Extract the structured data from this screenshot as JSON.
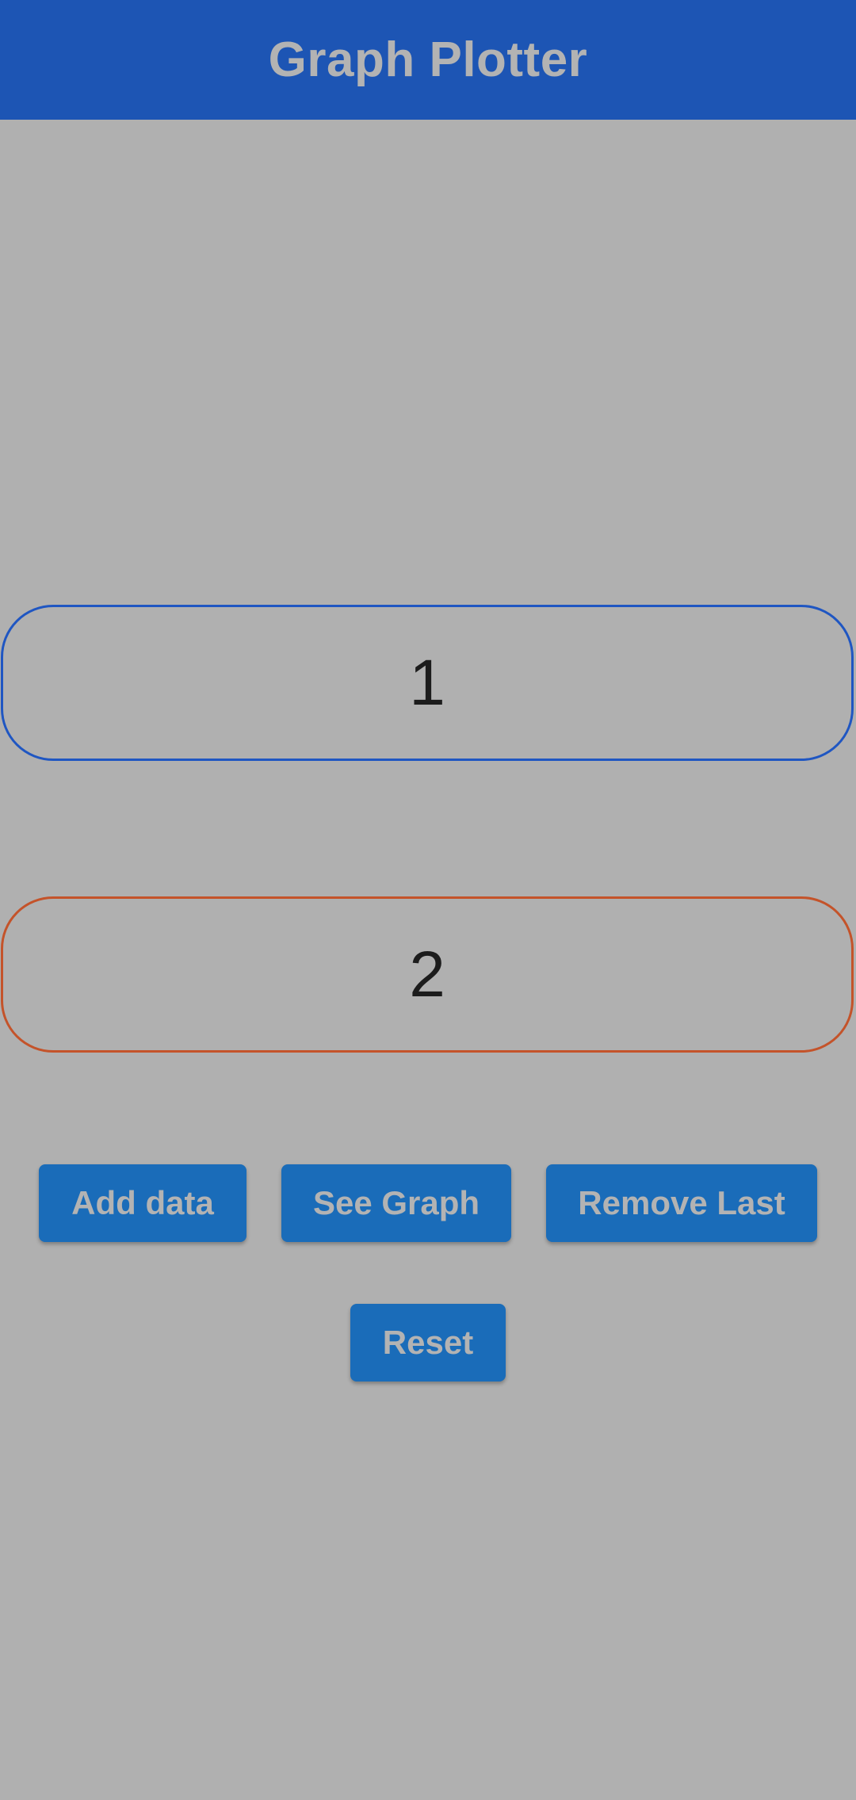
{
  "app_bar": {
    "title": "Graph Plotter"
  },
  "inputs": {
    "x_value": "1",
    "y_value": "2"
  },
  "buttons": {
    "add_data": "Add data",
    "see_graph": "See Graph",
    "remove_last": "Remove Last",
    "reset": "Reset"
  },
  "colors": {
    "app_bar": "#1d55b4",
    "background": "#b0b0b0",
    "button": "#1a6cb9",
    "field_1_border": "#1f56c2",
    "field_2_border": "#c4532a"
  }
}
